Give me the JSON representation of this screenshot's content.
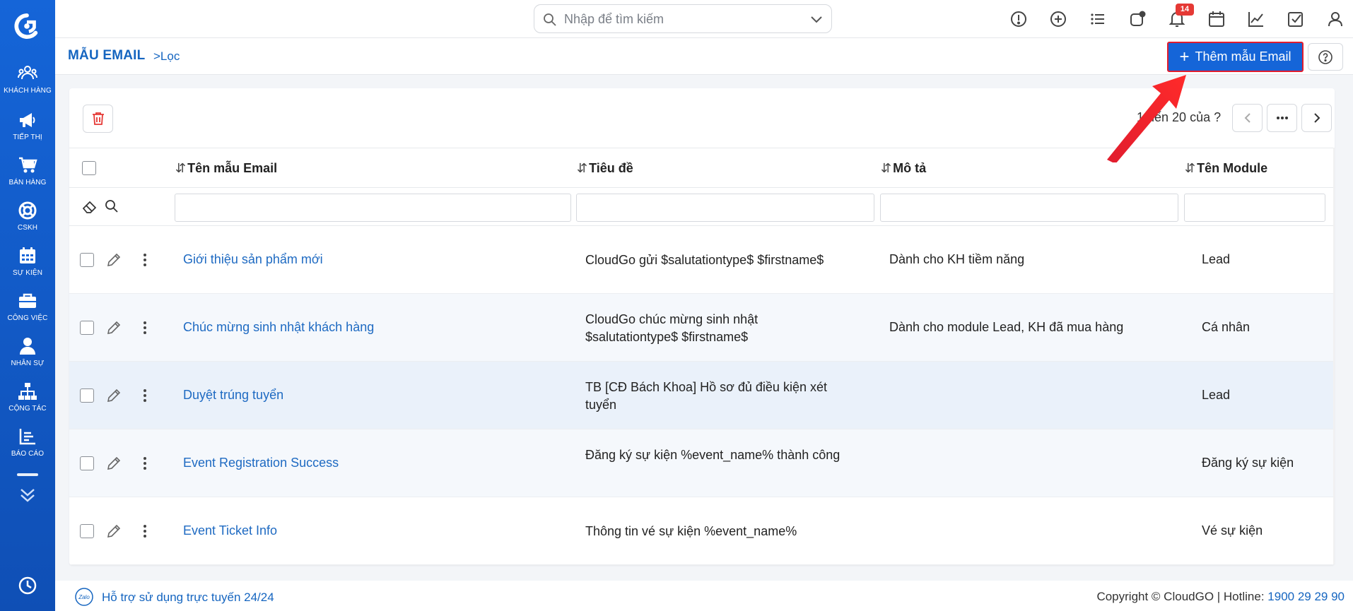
{
  "sidebar": {
    "items": [
      {
        "label": "KHÁCH HÀNG",
        "icon": "customers-icon"
      },
      {
        "label": "TIẾP THỊ",
        "icon": "megaphone-icon"
      },
      {
        "label": "BÁN HÀNG",
        "icon": "cart-icon"
      },
      {
        "label": "CSKH",
        "icon": "lifebuoy-icon"
      },
      {
        "label": "SỰ KIỆN",
        "icon": "calendar-icon"
      },
      {
        "label": "CÔNG VIỆC",
        "icon": "briefcase-icon"
      },
      {
        "label": "NHÂN SỰ",
        "icon": "user-icon"
      },
      {
        "label": "CỘNG TÁC",
        "icon": "org-chart-icon"
      },
      {
        "label": "BÁO CÁO",
        "icon": "report-icon"
      }
    ]
  },
  "topbar": {
    "search_placeholder": "Nhập để tìm kiếm",
    "notification_count": "14"
  },
  "header": {
    "title": "MẪU EMAIL",
    "filter_label": ">Lọc",
    "add_button_label": "Thêm mẫu Email"
  },
  "pager": {
    "text": "1 đến 20 của ?"
  },
  "table": {
    "columns": [
      "Tên mẫu Email",
      "Tiêu đề",
      "Mô tả",
      "Tên Module"
    ],
    "rows": [
      {
        "name": "Giới thiệu sản phẩm mới",
        "subject": "CloudGo gửi $salutationtype$ $firstname$",
        "description": "Dành cho KH tiềm năng",
        "module": "Lead"
      },
      {
        "name": "Chúc mừng sinh nhật khách hàng",
        "subject": "CloudGo chúc mừng sinh nhật $salutationtype$ $firstname$",
        "description": "Dành cho module Lead, KH đã mua hàng",
        "module": "Cá nhân"
      },
      {
        "name": "Duyệt trúng tuyển",
        "subject": "TB [CĐ Bách Khoa] Hồ sơ đủ điều kiện xét tuyển",
        "description": "",
        "module": "Lead"
      },
      {
        "name": "Event Registration Success",
        "subject": "Đăng ký sự kiện %event_name% thành công",
        "description": "",
        "module": "Đăng ký sự kiện"
      },
      {
        "name": "Event Ticket Info",
        "subject": "Thông tin vé sự kiện %event_name%",
        "description": "",
        "module": "Vé sự kiện"
      }
    ]
  },
  "footer": {
    "support_text": "Hỗ trợ sử dụng trực tuyến 24/24",
    "copyright": "Copyright © CloudGO | Hotline: ",
    "hotline": "1900 29 29 90"
  },
  "colors": {
    "sidebar": "#1565d8",
    "accent": "#1565c0",
    "annotation": "#e11d2e"
  }
}
